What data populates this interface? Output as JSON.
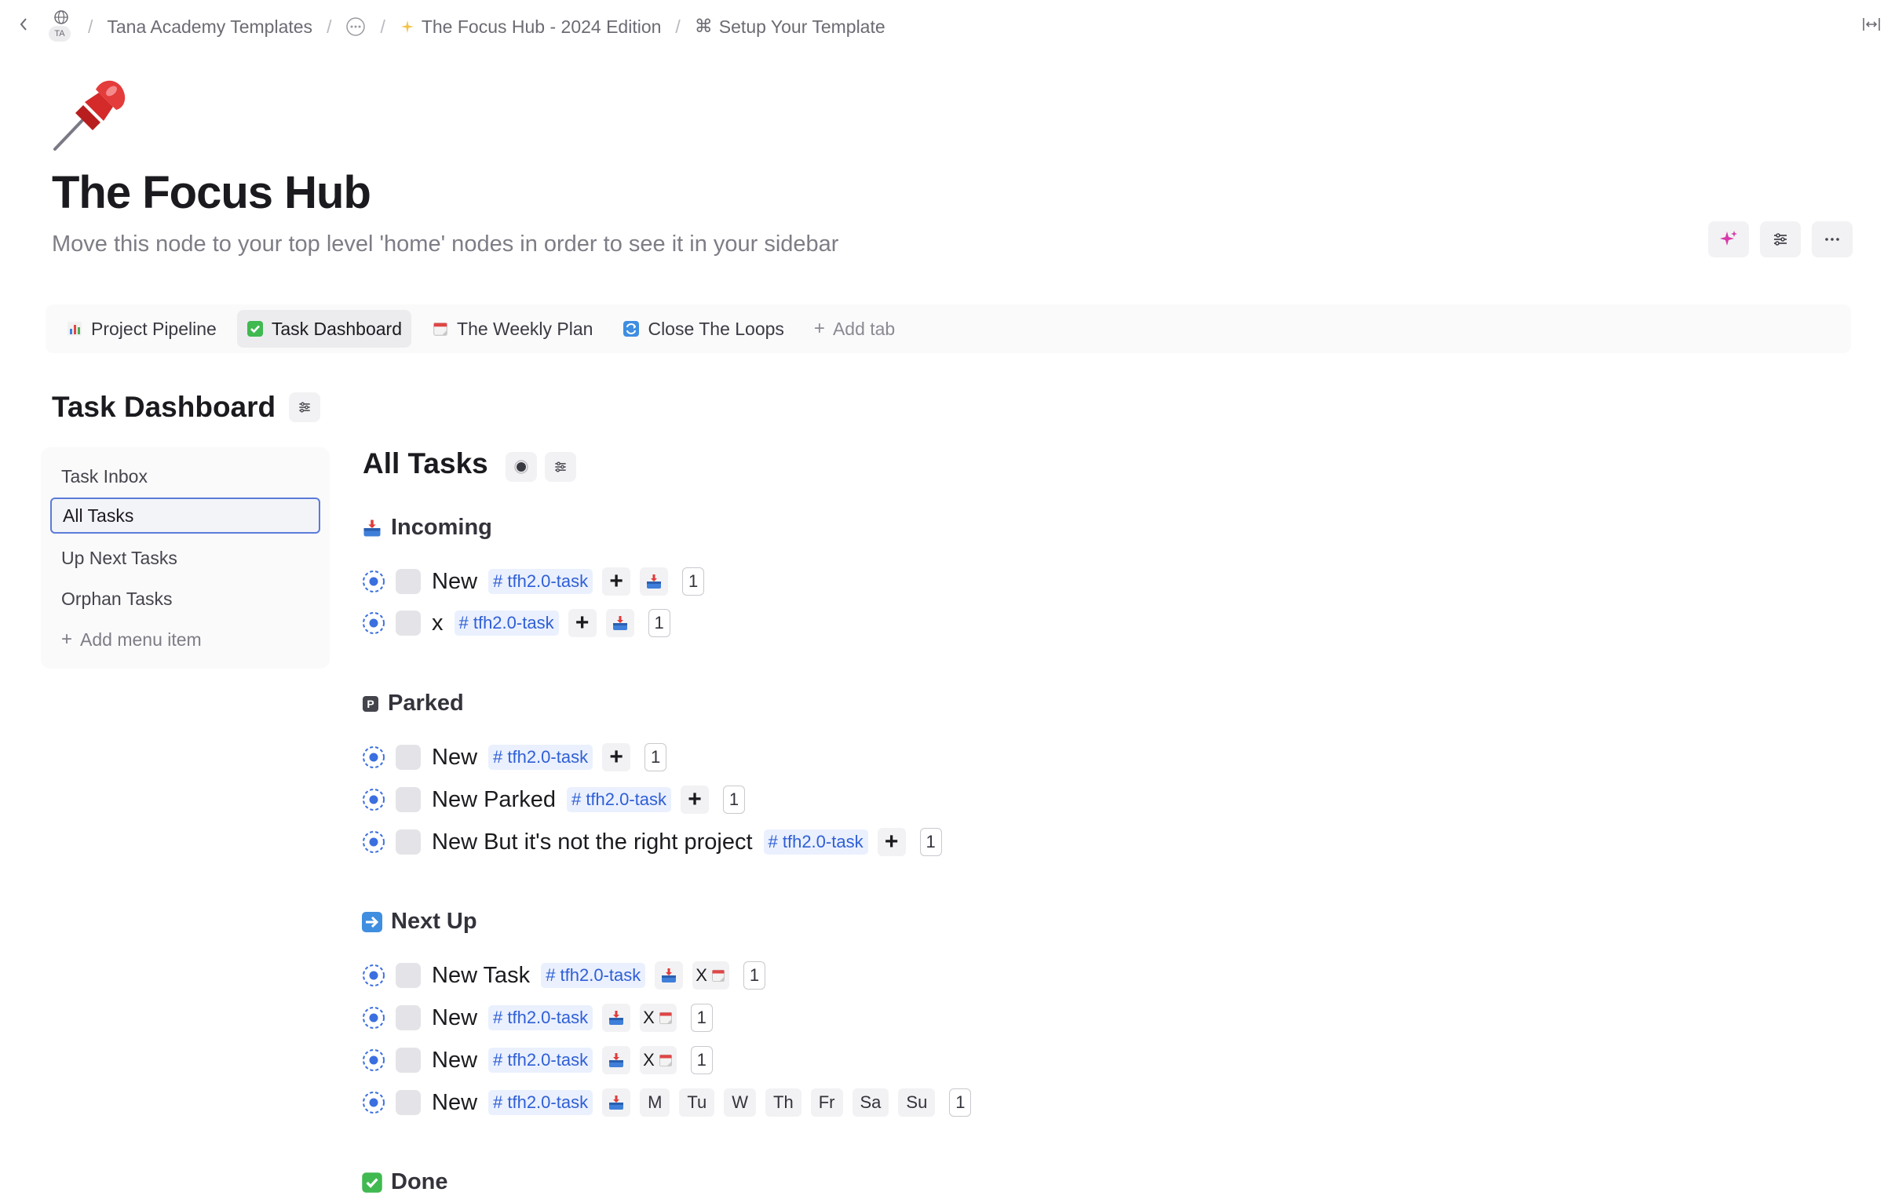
{
  "breadcrumb": {
    "workspace_badge": "TA",
    "items": [
      "Tana Academy Templates",
      "The Focus Hub - 2024 Edition",
      "Setup Your Template"
    ]
  },
  "page": {
    "title": "The Focus Hub",
    "subtitle": "Move this node to your top level 'home' nodes in order to see it in your sidebar"
  },
  "tabs": [
    {
      "label": "Project Pipeline",
      "icon": "bar-chart-icon"
    },
    {
      "label": "Task Dashboard",
      "icon": "check-mark-icon"
    },
    {
      "label": "The Weekly Plan",
      "icon": "calendar-icon"
    },
    {
      "label": "Close The Loops",
      "icon": "loop-icon"
    }
  ],
  "add_tab": "Add tab",
  "dashboard": {
    "title": "Task Dashboard",
    "menu": [
      "Task Inbox",
      "All Tasks",
      "Up Next Tasks",
      "Orphan Tasks"
    ],
    "add_menu_item": "Add menu item",
    "active_menu": "All Tasks"
  },
  "main": {
    "title": "All Tasks",
    "groups": {
      "incoming": {
        "label": "Incoming",
        "rows": [
          {
            "text": "New",
            "tag": "# tfh2.0-task",
            "count": "1"
          },
          {
            "text": "x",
            "tag": "# tfh2.0-task",
            "count": "1"
          }
        ]
      },
      "parked": {
        "label": "Parked",
        "rows": [
          {
            "text": "New",
            "tag": "# tfh2.0-task",
            "count": "1"
          },
          {
            "text": "New Parked",
            "tag": "# tfh2.0-task",
            "count": "1"
          },
          {
            "text": "New But it's not the right project",
            "tag": "# tfh2.0-task",
            "count": "1"
          }
        ]
      },
      "next_up": {
        "label": "Next Up",
        "rows": [
          {
            "text": "New Task",
            "tag": "# tfh2.0-task",
            "x": "X",
            "count": "1"
          },
          {
            "text": "New",
            "tag": "# tfh2.0-task",
            "x": "X",
            "count": "1"
          },
          {
            "text": "New",
            "tag": "# tfh2.0-task",
            "x": "X",
            "count": "1"
          },
          {
            "text": "New",
            "tag": "# tfh2.0-task",
            "days": [
              "M",
              "Tu",
              "W",
              "Th",
              "Fr",
              "Sa",
              "Su"
            ],
            "count": "1"
          }
        ]
      },
      "done": {
        "label": "Done"
      }
    }
  },
  "colors": {
    "accent": "#2f5fd6",
    "tag_bg": "#eaf0fd",
    "ai_magenta": "#d63aa8",
    "pin_red": "#d42a2a"
  }
}
